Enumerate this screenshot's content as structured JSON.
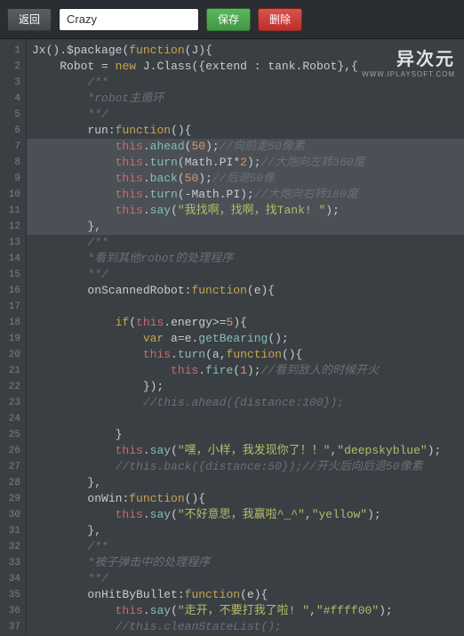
{
  "toolbar": {
    "back_label": "返回",
    "save_label": "保存",
    "delete_label": "删除",
    "name_value": "Crazy"
  },
  "watermark": {
    "title": "异次元",
    "subtitle": "WWW.IPLAYSOFT.COM"
  },
  "code": {
    "selected_range": [
      7,
      12
    ],
    "lines": [
      {
        "n": 1,
        "t": [
          [
            "id",
            "Jx"
          ],
          [
            "pn",
            "()."
          ],
          [
            "id",
            "$package"
          ],
          [
            "pn",
            "("
          ],
          [
            "kw",
            "function"
          ],
          [
            "pn",
            "("
          ],
          [
            "id",
            "J"
          ],
          [
            "pn",
            "){"
          ]
        ]
      },
      {
        "n": 2,
        "i": 1,
        "t": [
          [
            "id",
            "Robot"
          ],
          [
            "pn",
            " = "
          ],
          [
            "kw",
            "new"
          ],
          [
            "pn",
            " "
          ],
          [
            "id",
            "J"
          ],
          [
            "pn",
            "."
          ],
          [
            "id",
            "Class"
          ],
          [
            "pn",
            "({"
          ],
          [
            "id",
            "extend"
          ],
          [
            "pn",
            " : "
          ],
          [
            "id",
            "tank"
          ],
          [
            "pn",
            "."
          ],
          [
            "id",
            "Robot"
          ],
          [
            "pn",
            "},{"
          ]
        ]
      },
      {
        "n": 3,
        "i": 2,
        "t": [
          [
            "cm",
            "/**"
          ]
        ]
      },
      {
        "n": 4,
        "i": 2,
        "t": [
          [
            "cm",
            "*robot主循环"
          ]
        ]
      },
      {
        "n": 5,
        "i": 2,
        "t": [
          [
            "cm",
            "**/"
          ]
        ]
      },
      {
        "n": 6,
        "i": 2,
        "t": [
          [
            "prop",
            "run"
          ],
          [
            "pn",
            ":"
          ],
          [
            "kw",
            "function"
          ],
          [
            "pn",
            "(){"
          ]
        ]
      },
      {
        "n": 7,
        "i": 3,
        "t": [
          [
            "this",
            "this"
          ],
          [
            "pn",
            "."
          ],
          [
            "fn",
            "ahead"
          ],
          [
            "pn",
            "("
          ],
          [
            "num",
            "50"
          ],
          [
            "pn",
            ");"
          ],
          [
            "cm",
            "//向前走50像素"
          ]
        ]
      },
      {
        "n": 8,
        "i": 3,
        "t": [
          [
            "this",
            "this"
          ],
          [
            "pn",
            "."
          ],
          [
            "fn",
            "turn"
          ],
          [
            "pn",
            "("
          ],
          [
            "id",
            "Math"
          ],
          [
            "pn",
            "."
          ],
          [
            "id",
            "PI"
          ],
          [
            "pn",
            "*"
          ],
          [
            "num",
            "2"
          ],
          [
            "pn",
            ");"
          ],
          [
            "cm",
            "//大炮向左转360度"
          ]
        ]
      },
      {
        "n": 9,
        "i": 3,
        "t": [
          [
            "this",
            "this"
          ],
          [
            "pn",
            "."
          ],
          [
            "fn",
            "back"
          ],
          [
            "pn",
            "("
          ],
          [
            "num",
            "50"
          ],
          [
            "pn",
            ");"
          ],
          [
            "cm",
            "//后退50像"
          ]
        ]
      },
      {
        "n": 10,
        "i": 3,
        "t": [
          [
            "this",
            "this"
          ],
          [
            "pn",
            "."
          ],
          [
            "fn",
            "turn"
          ],
          [
            "pn",
            "(-"
          ],
          [
            "id",
            "Math"
          ],
          [
            "pn",
            "."
          ],
          [
            "id",
            "PI"
          ],
          [
            "pn",
            ");"
          ],
          [
            "cm",
            "//大炮向右转180度"
          ]
        ]
      },
      {
        "n": 11,
        "i": 3,
        "t": [
          [
            "this",
            "this"
          ],
          [
            "pn",
            "."
          ],
          [
            "fn",
            "say"
          ],
          [
            "pn",
            "("
          ],
          [
            "str",
            "\"我找啊，找啊，找Tank! \""
          ],
          [
            "pn",
            ");"
          ]
        ]
      },
      {
        "n": 12,
        "i": 2,
        "t": [
          [
            "pn",
            "},"
          ]
        ]
      },
      {
        "n": 13,
        "i": 2,
        "t": [
          [
            "cm",
            "/**"
          ]
        ]
      },
      {
        "n": 14,
        "i": 2,
        "t": [
          [
            "cm",
            "*看到其他robot的处理程序"
          ]
        ]
      },
      {
        "n": 15,
        "i": 2,
        "t": [
          [
            "cm",
            "**/"
          ]
        ]
      },
      {
        "n": 16,
        "i": 2,
        "t": [
          [
            "prop",
            "onScannedRobot"
          ],
          [
            "pn",
            ":"
          ],
          [
            "kw",
            "function"
          ],
          [
            "pn",
            "("
          ],
          [
            "id",
            "e"
          ],
          [
            "pn",
            "){"
          ]
        ]
      },
      {
        "n": 17,
        "i": 0,
        "t": []
      },
      {
        "n": 18,
        "i": 3,
        "t": [
          [
            "kw",
            "if"
          ],
          [
            "pn",
            "("
          ],
          [
            "this",
            "this"
          ],
          [
            "pn",
            "."
          ],
          [
            "id",
            "energy"
          ],
          [
            "pn",
            ">="
          ],
          [
            "num",
            "5"
          ],
          [
            "pn",
            "){"
          ]
        ]
      },
      {
        "n": 19,
        "i": 4,
        "t": [
          [
            "kw",
            "var"
          ],
          [
            "pn",
            " "
          ],
          [
            "id",
            "a"
          ],
          [
            "pn",
            "="
          ],
          [
            "id",
            "e"
          ],
          [
            "pn",
            "."
          ],
          [
            "fn",
            "getBearing"
          ],
          [
            "pn",
            "();"
          ]
        ]
      },
      {
        "n": 20,
        "i": 4,
        "t": [
          [
            "this",
            "this"
          ],
          [
            "pn",
            "."
          ],
          [
            "fn",
            "turn"
          ],
          [
            "pn",
            "("
          ],
          [
            "id",
            "a"
          ],
          [
            "pn",
            ","
          ],
          [
            "kw",
            "function"
          ],
          [
            "pn",
            "(){"
          ]
        ]
      },
      {
        "n": 21,
        "i": 5,
        "t": [
          [
            "this",
            "this"
          ],
          [
            "pn",
            "."
          ],
          [
            "fn",
            "fire"
          ],
          [
            "pn",
            "("
          ],
          [
            "num",
            "1"
          ],
          [
            "pn",
            ");"
          ],
          [
            "cm",
            "//看到敌人的时候开火"
          ]
        ]
      },
      {
        "n": 22,
        "i": 4,
        "t": [
          [
            "pn",
            "});"
          ]
        ]
      },
      {
        "n": 23,
        "i": 4,
        "t": [
          [
            "cm",
            "//this.ahead({distance:100});"
          ]
        ]
      },
      {
        "n": 24,
        "i": 0,
        "t": []
      },
      {
        "n": 25,
        "i": 3,
        "t": [
          [
            "pn",
            "}"
          ]
        ]
      },
      {
        "n": 26,
        "i": 3,
        "t": [
          [
            "this",
            "this"
          ],
          [
            "pn",
            "."
          ],
          [
            "fn",
            "say"
          ],
          [
            "pn",
            "("
          ],
          [
            "str",
            "\"嘿，小样，我发现你了！！\""
          ],
          [
            "pn",
            ","
          ],
          [
            "str",
            "\"deepskyblue\""
          ],
          [
            "pn",
            ");"
          ]
        ]
      },
      {
        "n": 27,
        "i": 3,
        "t": [
          [
            "cm",
            "//this.back({distance:50});//开火后向后退50像素"
          ]
        ]
      },
      {
        "n": 28,
        "i": 2,
        "t": [
          [
            "pn",
            "},"
          ]
        ]
      },
      {
        "n": 29,
        "i": 2,
        "t": [
          [
            "prop",
            "onWin"
          ],
          [
            "pn",
            ":"
          ],
          [
            "kw",
            "function"
          ],
          [
            "pn",
            "(){"
          ]
        ]
      },
      {
        "n": 30,
        "i": 3,
        "t": [
          [
            "this",
            "this"
          ],
          [
            "pn",
            "."
          ],
          [
            "fn",
            "say"
          ],
          [
            "pn",
            "("
          ],
          [
            "str",
            "\"不好意思，我赢啦^_^\""
          ],
          [
            "pn",
            ","
          ],
          [
            "str",
            "\"yellow\""
          ],
          [
            "pn",
            ");"
          ]
        ]
      },
      {
        "n": 31,
        "i": 2,
        "t": [
          [
            "pn",
            "},"
          ]
        ]
      },
      {
        "n": 32,
        "i": 2,
        "t": [
          [
            "cm",
            "/**"
          ]
        ]
      },
      {
        "n": 33,
        "i": 2,
        "t": [
          [
            "cm",
            "*被子弹击中的处理程序"
          ]
        ]
      },
      {
        "n": 34,
        "i": 2,
        "t": [
          [
            "cm",
            "**/"
          ]
        ]
      },
      {
        "n": 35,
        "i": 2,
        "t": [
          [
            "prop",
            "onHitByBullet"
          ],
          [
            "pn",
            ":"
          ],
          [
            "kw",
            "function"
          ],
          [
            "pn",
            "("
          ],
          [
            "id",
            "e"
          ],
          [
            "pn",
            "){"
          ]
        ]
      },
      {
        "n": 36,
        "i": 3,
        "t": [
          [
            "this",
            "this"
          ],
          [
            "pn",
            "."
          ],
          [
            "fn",
            "say"
          ],
          [
            "pn",
            "("
          ],
          [
            "str",
            "\"走开，不要打我了啦! \""
          ],
          [
            "pn",
            ","
          ],
          [
            "str",
            "\"#ffff00\""
          ],
          [
            "pn",
            ");"
          ]
        ]
      },
      {
        "n": 37,
        "i": 3,
        "t": [
          [
            "cm",
            "//this.cleanStateList();"
          ]
        ]
      }
    ]
  }
}
